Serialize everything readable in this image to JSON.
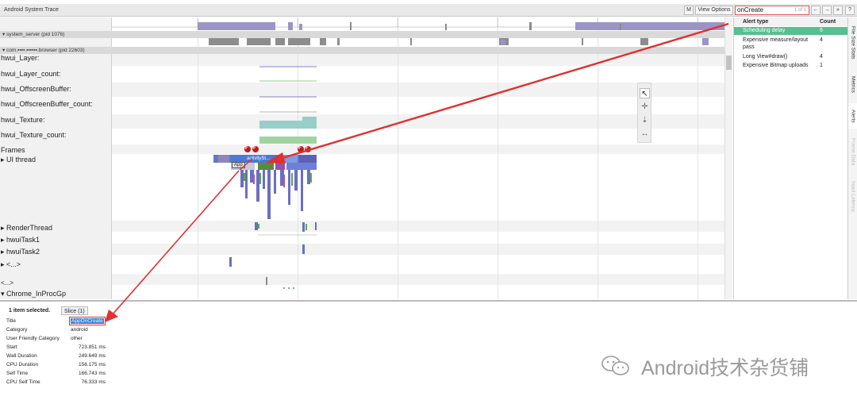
{
  "window": {
    "title": "Android System Trace"
  },
  "toolbar": {
    "m_label": "M",
    "view_options_label": "View Options",
    "search_value": "onCreate",
    "search_count": "1 of 1",
    "prev_label": "←",
    "next_label": "→",
    "close_label": "»",
    "help_label": "?"
  },
  "processes": [
    {
      "label": "▾ system_server (pid 1076)"
    },
    {
      "label": "▾ com.▪▪▪▪.▪▪▪▪▪▪.browser (pid 22603)"
    }
  ],
  "tracks": {
    "hwui_layer": "hwui_Layer:",
    "hwui_layer_count": "hwui_Layer_count:",
    "hwui_offscreen": "hwui_OffscreenBuffer:",
    "hwui_offscreen_count": "hwui_OffscreenBuffer_count:",
    "hwui_texture": "hwui_Texture:",
    "hwui_texture_count": "hwui_Texture_count:",
    "frames": "Frames",
    "ui_thread": "▸  UI thread",
    "render_thread": "▸  RenderThread",
    "hwui_task1": "▸  hwuiTask1",
    "hwui_task2": "▸  hwuiTask2",
    "ellipsis_thread": "▸  <...>",
    "ellipsis_process": "<...>",
    "chrome": "▾  Chrome_InProcGp"
  },
  "timeline": {
    "frame_markers": [
      "F",
      "F",
      "F",
      "F"
    ],
    "slice_activity": "activitySt...",
    "slice_app": "App"
  },
  "alerts": {
    "header_type": "Alert type",
    "header_count": "Count",
    "rows": [
      {
        "type": "Scheduling delay",
        "count": "6",
        "selected": true
      },
      {
        "type": "Expensive measure/layout pass",
        "count": "4",
        "selected": false
      },
      {
        "type": "Long View#draw()",
        "count": "4",
        "selected": false
      },
      {
        "type": "Expensive Bitmap uploads",
        "count": "1",
        "selected": false
      }
    ]
  },
  "side_tabs": [
    "File Size Stats",
    "Metrics",
    "Alerts",
    "Frame Data",
    "Input Latency"
  ],
  "details": {
    "selected_label": "1 item selected.",
    "tab_label": "Slice (1)",
    "rows": [
      {
        "key": "Title",
        "value": "AppOnCreate"
      },
      {
        "key": "Category",
        "value": "android"
      },
      {
        "key": "User Friendly Category",
        "value": "other"
      },
      {
        "key": "Start",
        "value": "723.851 ms"
      },
      {
        "key": "Wall Duration",
        "value": "249.649 ms"
      },
      {
        "key": "CPU Duration",
        "value": "156.175 ms"
      },
      {
        "key": "Self Time",
        "value": "166.743 ms"
      },
      {
        "key": "CPU Self Time",
        "value": "76.333 ms"
      }
    ]
  },
  "watermark": {
    "text": "Android技术杂货铺"
  },
  "colors": {
    "alert_selected": "#58bf8f",
    "annotation_arrow": "#e03030",
    "highlight": "#3a7fd0"
  }
}
